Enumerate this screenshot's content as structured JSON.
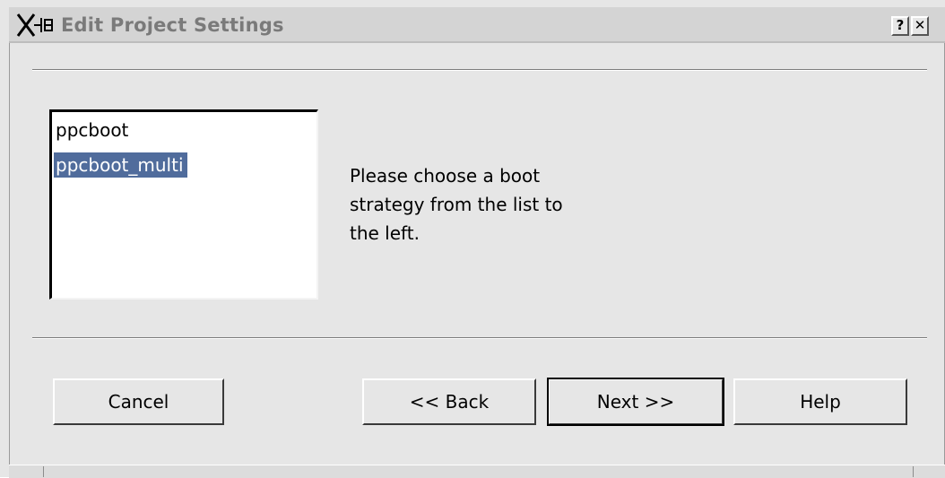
{
  "window": {
    "title": "Edit Project Settings",
    "help_button_label": "?",
    "close_button_label": "✕"
  },
  "boot_list": {
    "items": [
      "ppcboot",
      "ppcboot_multi"
    ],
    "selected": "ppcboot_multi"
  },
  "instruction": {
    "line1": "Please choose a boot",
    "line2": "strategy from the list to",
    "line3": "the left."
  },
  "buttons": {
    "cancel": "Cancel",
    "back": "<< Back",
    "next": "Next >>",
    "help": "Help"
  },
  "colors": {
    "selection_background": "#506c9c",
    "selection_text": "#ffffff",
    "window_background": "#e6e6e6",
    "title_text": "#7a7a7a"
  },
  "icons": {
    "window_menu": "x-window-icon"
  }
}
